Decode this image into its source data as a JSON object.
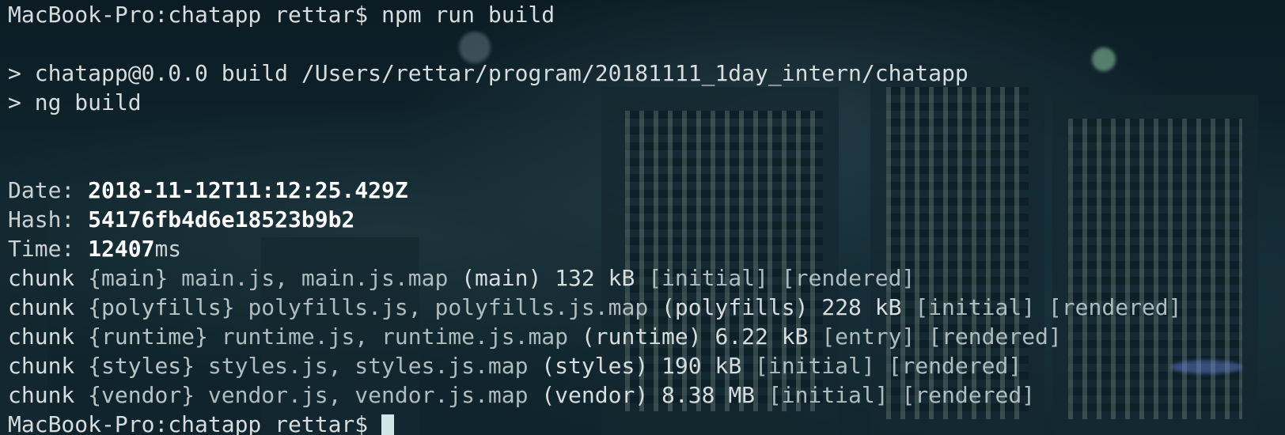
{
  "terminal": {
    "prompt_line": "MacBook-Pro:chatapp rettar$ npm run build",
    "script_line": "> chatapp@0.0.0 build /Users/rettar/program/20181111_1day_intern/chatapp",
    "ng_line": "> ng build",
    "date_label": "Date: ",
    "date_value": "2018-11-12T11:12:25.429Z",
    "hash_label": "Hash: ",
    "hash_value": "54176fb4d6e18523b9b2",
    "time_label": "Time: ",
    "time_value": "12407",
    "time_unit": "ms",
    "chunks": [
      {
        "prefix": "chunk ",
        "name": "{main}",
        "files": " main.js, main.js.map",
        "rest": " (main) 132 kB ",
        "tags": "[initial] [rendered]"
      },
      {
        "prefix": "chunk ",
        "name": "{polyfills}",
        "files": " polyfills.js, polyfills.js.map",
        "rest": " (polyfills) 228 kB ",
        "tags": "[initial] [rendered]"
      },
      {
        "prefix": "chunk ",
        "name": "{runtime}",
        "files": " runtime.js, runtime.js.map",
        "rest": " (runtime) 6.22 kB ",
        "tags": "[entry] [rendered]"
      },
      {
        "prefix": "chunk ",
        "name": "{styles}",
        "files": " styles.js, styles.js.map",
        "rest": " (styles) 190 kB ",
        "tags": "[initial] [rendered]"
      },
      {
        "prefix": "chunk ",
        "name": "{vendor}",
        "files": " vendor.js, vendor.js.map",
        "rest": " (vendor) 8.38 MB ",
        "tags": "[initial] [rendered]"
      }
    ],
    "final_prompt": "MacBook-Pro:chatapp rettar$ "
  }
}
